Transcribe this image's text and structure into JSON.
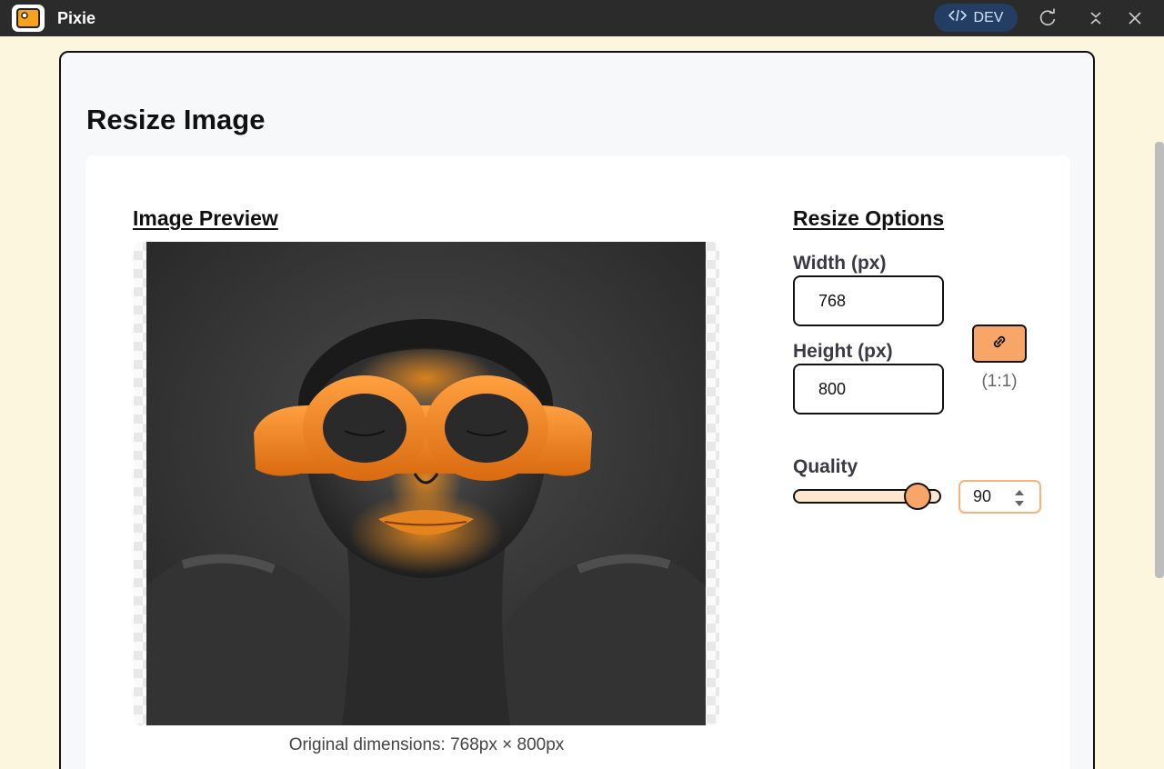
{
  "window": {
    "app_title": "Pixie",
    "dev_label": "DEV",
    "icons": [
      "code-icon",
      "refresh-icon",
      "collapse-icon",
      "close-icon"
    ]
  },
  "page": {
    "title": "Resize Image"
  },
  "preview": {
    "section_title": "Image Preview",
    "caption": "Original dimensions: 768px × 800px"
  },
  "options": {
    "section_title": "Resize Options",
    "width_label": "Width (px)",
    "width_value": "768",
    "height_label": "Height (px)",
    "height_value": "800",
    "aspect_ratio": "(1:1)",
    "quality_label": "Quality",
    "quality_value": "90",
    "quality_level": 90
  },
  "colors": {
    "accent": "#f7a667",
    "titlebar": "#2b2b2b",
    "dev_pill": "#233e62",
    "background": "#fdf6df"
  }
}
